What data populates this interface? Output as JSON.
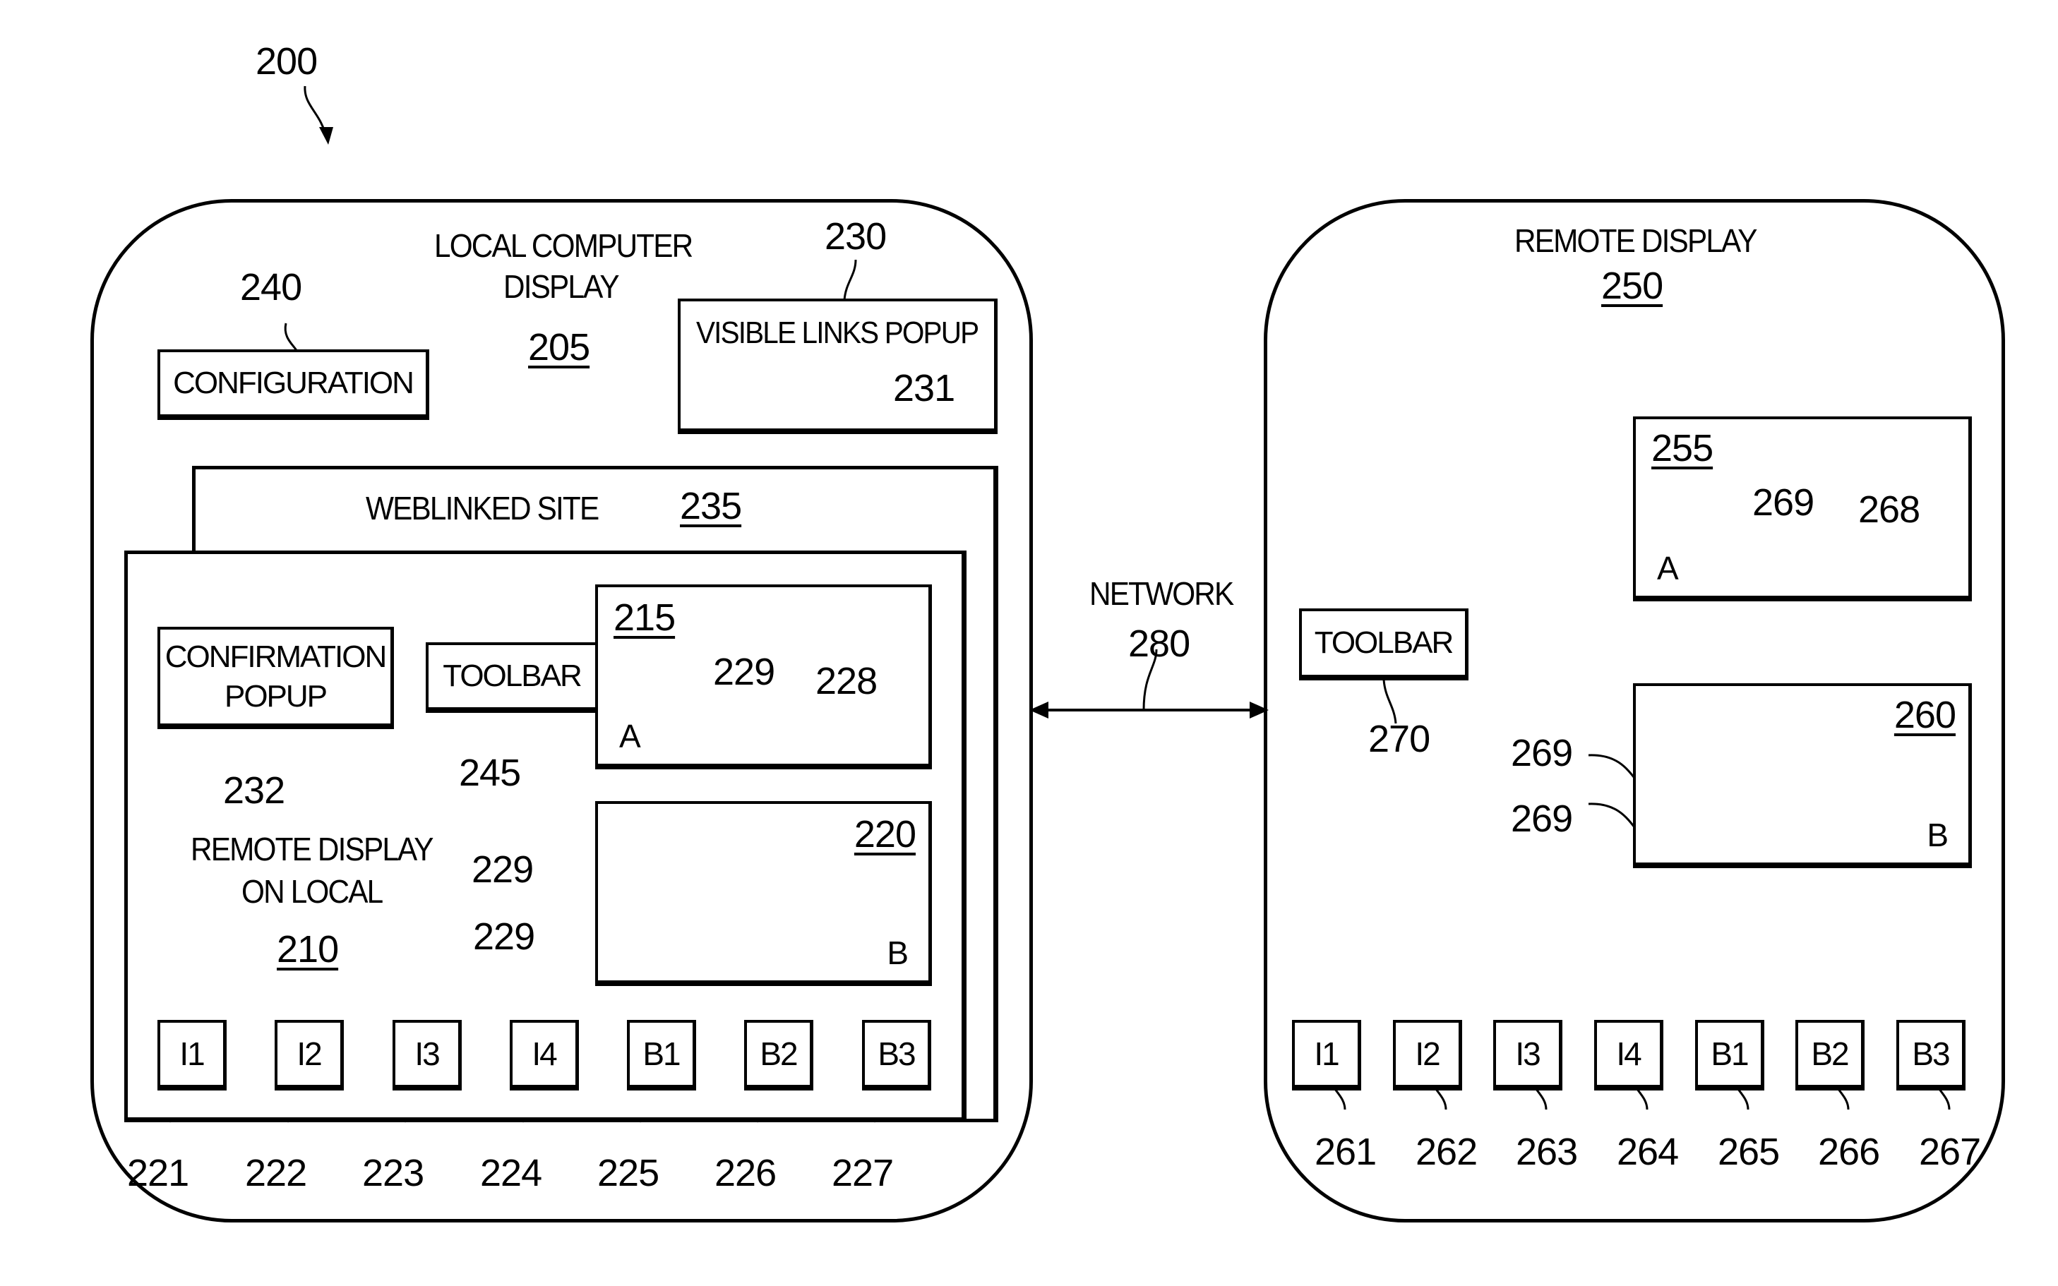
{
  "figure": {
    "ref": "200",
    "colors": {
      "ink": "#000000",
      "background": "#ffffff"
    }
  },
  "local": {
    "title_line1": "LOCAL COMPUTER",
    "title_line2": "DISPLAY",
    "ref": "205",
    "configuration": {
      "label": "CONFIGURATION",
      "ref": "240"
    },
    "visible_links_popup": {
      "label": "VISIBLE LINKS POPUP",
      "ref": "230",
      "link_ref": "231"
    },
    "weblinked_site": {
      "label": "WEBLINKED SITE",
      "ref": "235"
    },
    "remote_display_on_local": {
      "label_line1": "REMOTE DISPLAY",
      "label_line2": "ON LOCAL",
      "ref": "210",
      "confirmation_popup": {
        "label_line1": "CONFIRMATION",
        "label_line2": "POPUP",
        "ref": "232"
      },
      "toolbar": {
        "label": "TOOLBAR",
        "ref": "245"
      },
      "window_a": {
        "ref": "215",
        "letter": "A",
        "link_ref": "229",
        "dashed_ref": "228"
      },
      "window_b": {
        "ref": "220",
        "letter": "B",
        "link_refs": [
          "229",
          "229"
        ]
      },
      "icons": [
        {
          "label": "I1",
          "ref": "221"
        },
        {
          "label": "I2",
          "ref": "222"
        },
        {
          "label": "I3",
          "ref": "223"
        },
        {
          "label": "I4",
          "ref": "224"
        },
        {
          "label": "B1",
          "ref": "225"
        },
        {
          "label": "B2",
          "ref": "226"
        },
        {
          "label": "B3",
          "ref": "227"
        }
      ]
    }
  },
  "network": {
    "label": "NETWORK",
    "ref": "280"
  },
  "remote": {
    "title": "REMOTE DISPLAY",
    "ref": "250",
    "toolbar": {
      "label": "TOOLBAR",
      "ref": "270"
    },
    "window_a": {
      "ref": "255",
      "letter": "A",
      "link_ref": "269",
      "dashed_ref": "268"
    },
    "window_b": {
      "ref": "260",
      "letter": "B",
      "link_refs": [
        "269",
        "269"
      ]
    },
    "icons": [
      {
        "label": "I1",
        "ref": "261"
      },
      {
        "label": "I2",
        "ref": "262"
      },
      {
        "label": "I3",
        "ref": "263"
      },
      {
        "label": "I4",
        "ref": "264"
      },
      {
        "label": "B1",
        "ref": "265"
      },
      {
        "label": "B2",
        "ref": "266"
      },
      {
        "label": "B3",
        "ref": "267"
      }
    ]
  }
}
